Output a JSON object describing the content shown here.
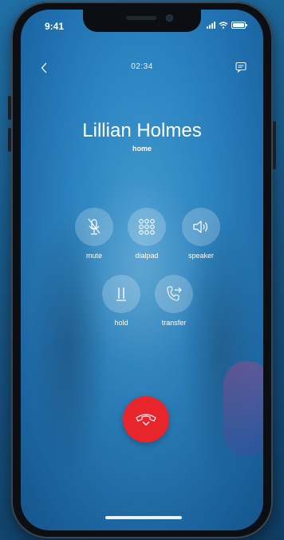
{
  "status_bar": {
    "time": "9:41"
  },
  "call_header": {
    "timer": "02:34",
    "back_icon": "chevron-left-icon",
    "chat_icon": "chat-icon"
  },
  "caller": {
    "name": "Lillian Holmes",
    "line_type": "home"
  },
  "controls": [
    {
      "id": "mute",
      "label": "mute",
      "icon": "microphone-mute-icon"
    },
    {
      "id": "dialpad",
      "label": "dialpad",
      "icon": "dialpad-icon"
    },
    {
      "id": "speaker",
      "label": "speaker",
      "icon": "speaker-icon"
    },
    {
      "id": "hold",
      "label": "hold",
      "icon": "pause-icon"
    },
    {
      "id": "transfer",
      "label": "transfer",
      "icon": "transfer-icon"
    }
  ],
  "end_call": {
    "icon": "end-call-icon",
    "color": "#e8252b"
  },
  "colors": {
    "background_blue": "#2f8ac7",
    "accent_red": "#e8252b",
    "text": "#ffffff"
  }
}
